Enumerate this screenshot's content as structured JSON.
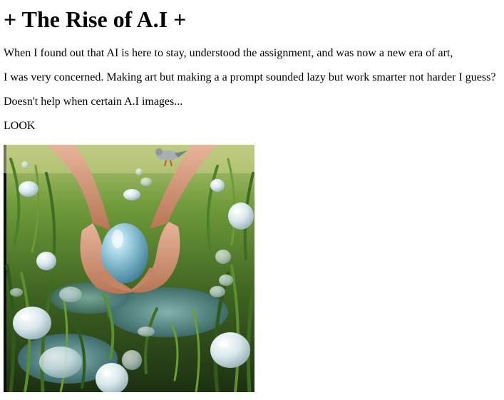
{
  "article": {
    "title": "+ The Rise of A.I +",
    "paragraphs": [
      "When I found out that AI is here to stay, understood the assignment, and was now a new era of art,",
      "I was very concerned. Making art but making a a prompt sounded lazy but work smarter not harder I guess?",
      "Doesn't help when certain A.I images...",
      "LOOK"
    ]
  },
  "image": {
    "subject": "hands-holding-egg-in-grass-with-bubbles"
  },
  "colors": {
    "text": "#000000",
    "background": "#ffffff",
    "grass": "#4e7a2a",
    "egg": "#7fb6cc",
    "skin": "#c98e6e"
  }
}
